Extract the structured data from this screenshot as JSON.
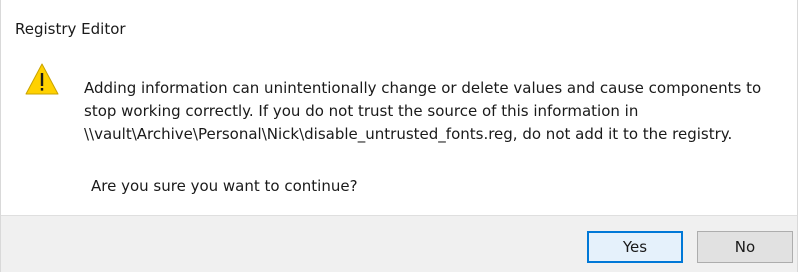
{
  "window": {
    "title": "Registry Editor"
  },
  "message": {
    "icon": "warning-icon",
    "lines": [
      "Adding information can unintentionally change or delete values and cause components to",
      "stop working correctly. If you do not trust the source of this information in",
      "\\\\vault\\Archive\\Personal\\Nick\\disable_untrusted_fonts.reg, do not add it to the registry."
    ],
    "question": "Are you sure you want to continue?"
  },
  "buttons": {
    "yes": "Yes",
    "no": "No"
  },
  "colors": {
    "footer_bg": "#f0f0f0",
    "default_button_border": "#0078d7",
    "warning_fill": "#ffd100"
  }
}
